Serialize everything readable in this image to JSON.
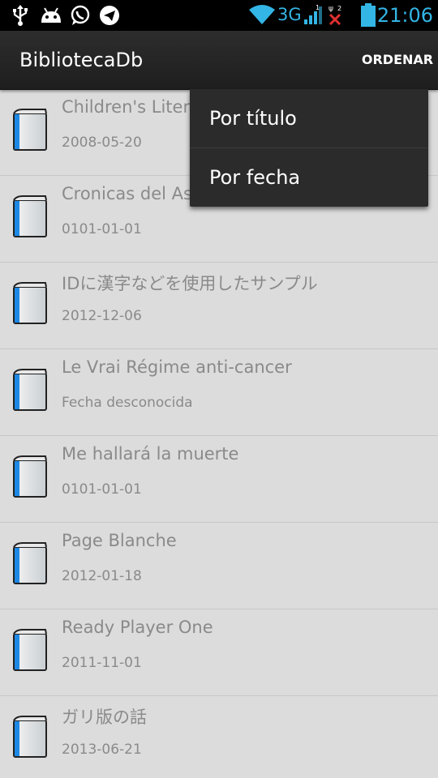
{
  "status_bar": {
    "network_label": "3G",
    "time": "21:06",
    "icons": [
      "usb-icon",
      "android-icon",
      "whatsapp-icon",
      "telegram-icon",
      "wifi-icon",
      "signal-icon",
      "no-signal-icon",
      "battery-icon"
    ],
    "accent_color": "#33b5e5"
  },
  "action_bar": {
    "title": "BibliotecaDb",
    "sort_label": "ORDENAR"
  },
  "sort_menu": {
    "items": [
      {
        "label": "Por título"
      },
      {
        "label": "Por fecha"
      }
    ]
  },
  "books": [
    {
      "title": "Children's Literature",
      "date": "2008-05-20"
    },
    {
      "title": "Cronicas del Asesino de Reyes",
      "date": "0101-01-01"
    },
    {
      "title": "IDに漢字などを使用したサンプル",
      "date": "2012-12-06"
    },
    {
      "title": "Le Vrai Régime anti-cancer",
      "date": "Fecha desconocida"
    },
    {
      "title": "Me hallará la muerte",
      "date": "0101-01-01"
    },
    {
      "title": "Page Blanche",
      "date": "2012-01-18"
    },
    {
      "title": "Ready Player One",
      "date": "2011-11-01"
    },
    {
      "title": "ガリ版の話",
      "date": "2013-06-21"
    }
  ],
  "book_icon_name": "book-icon"
}
